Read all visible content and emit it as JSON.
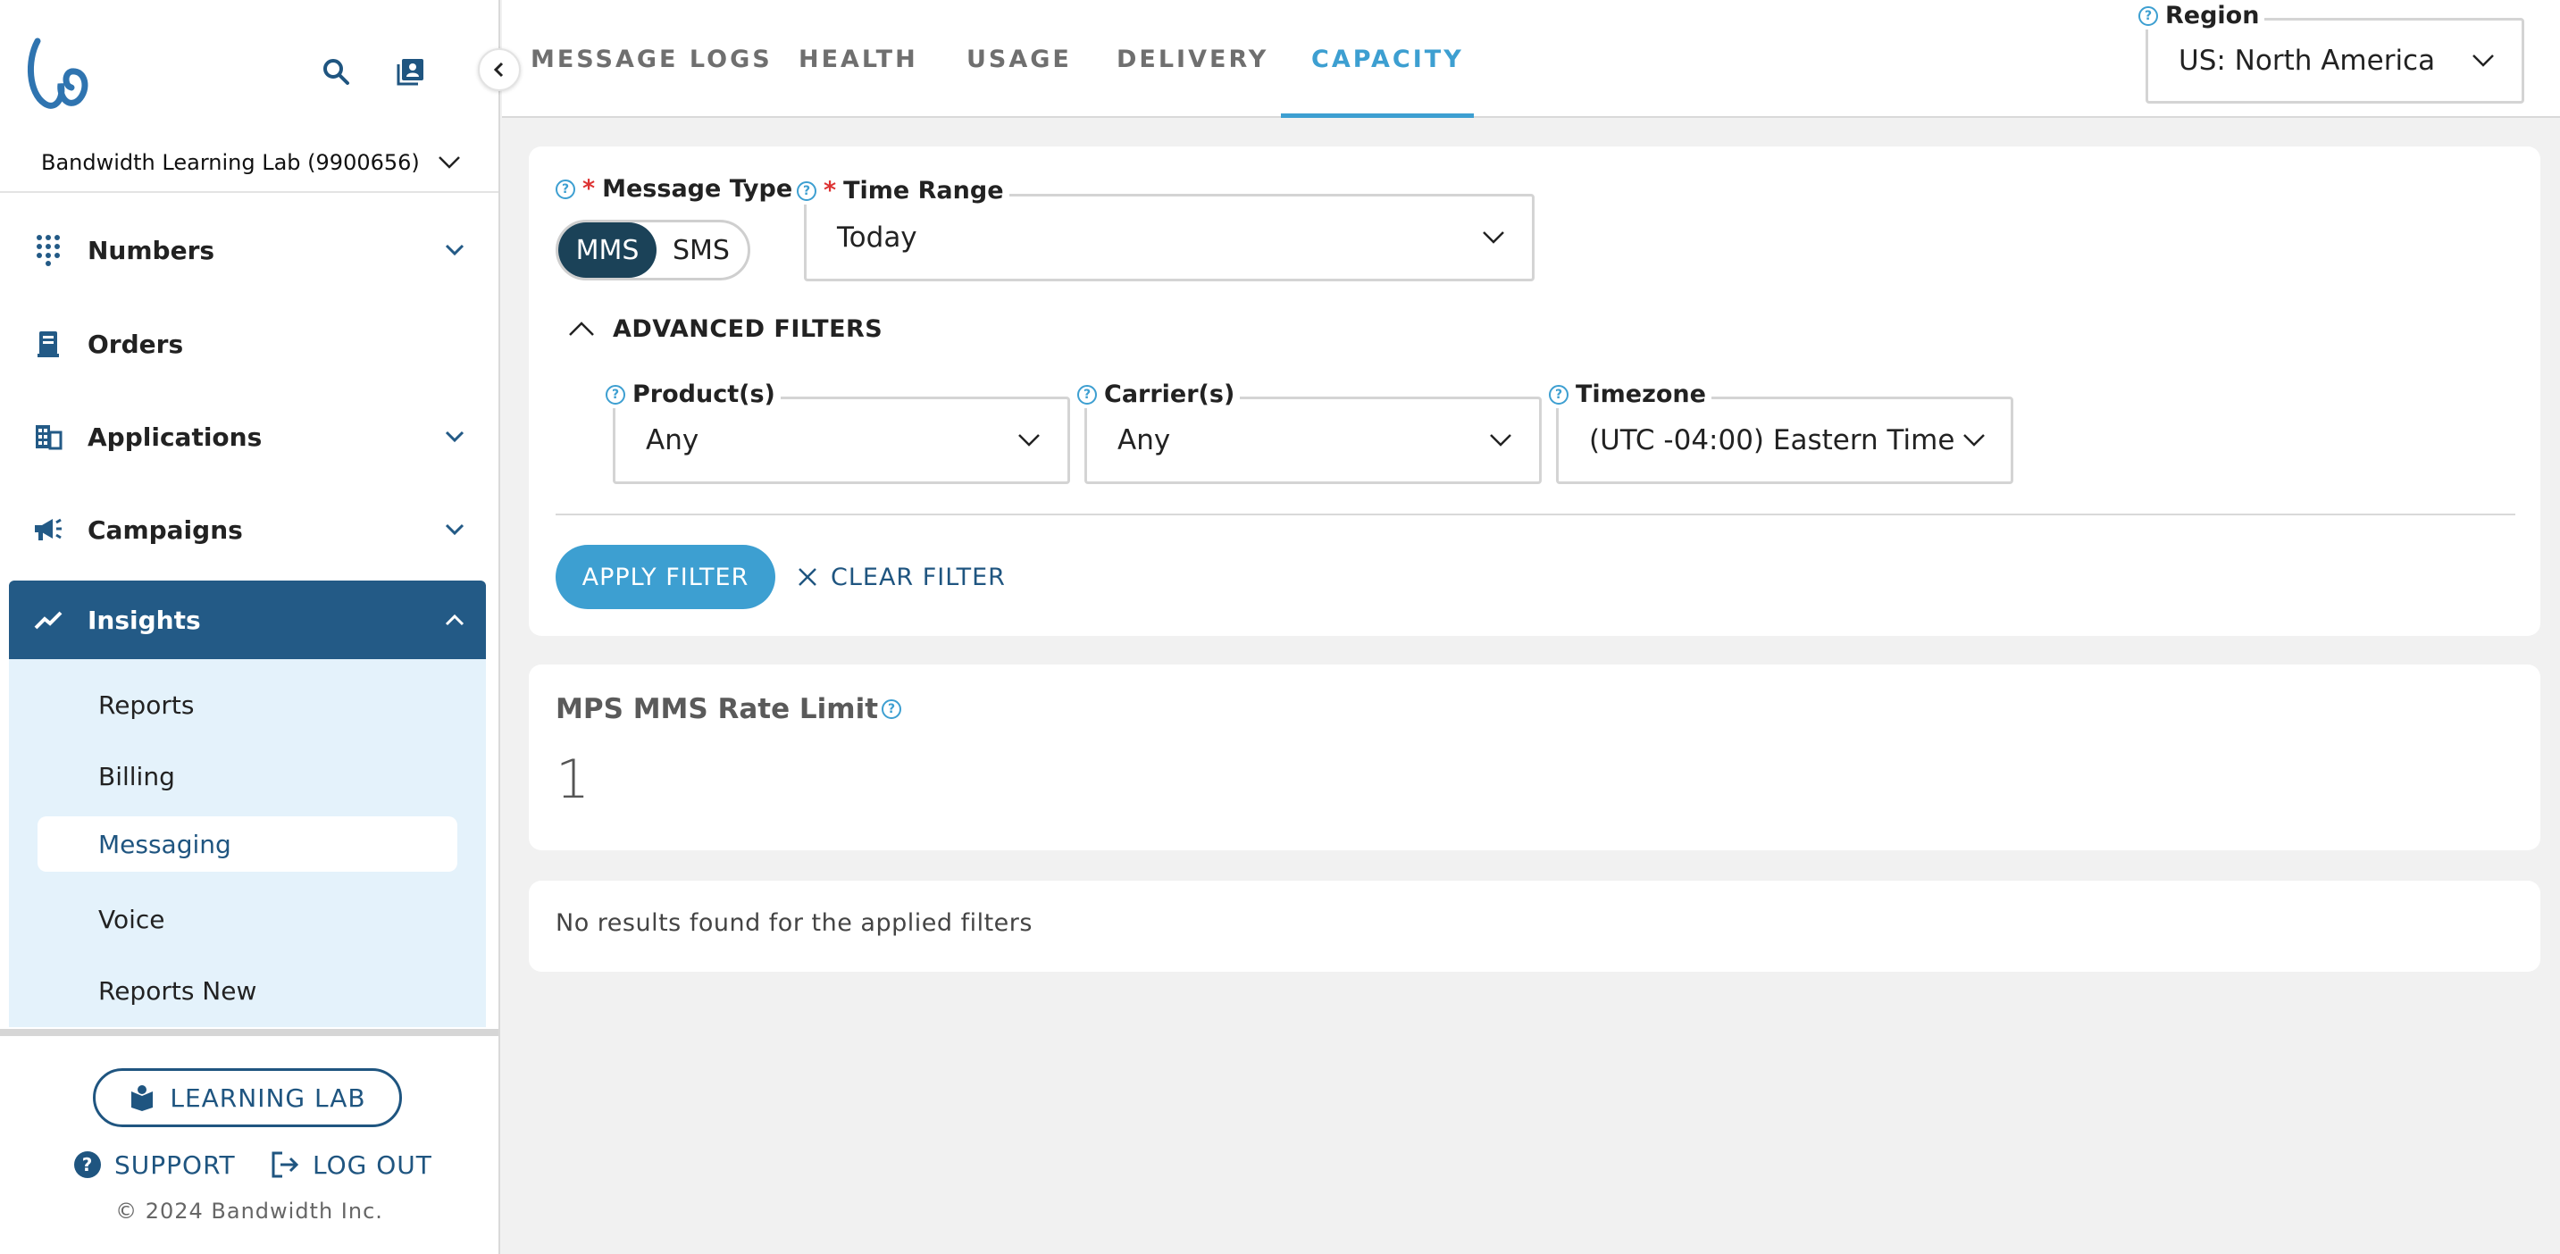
{
  "sidebar": {
    "account_name": "Bandwidth Learning Lab (9900656)",
    "nav": [
      {
        "label": "Numbers",
        "icon": "dialpad-icon",
        "expandable": true
      },
      {
        "label": "Orders",
        "icon": "receipt-icon",
        "expandable": false
      },
      {
        "label": "Applications",
        "icon": "building-icon",
        "expandable": true
      },
      {
        "label": "Campaigns",
        "icon": "megaphone-icon",
        "expandable": true
      },
      {
        "label": "Insights",
        "icon": "trending-icon",
        "expandable": true,
        "expanded": true
      }
    ],
    "subnav": [
      {
        "label": "Reports"
      },
      {
        "label": "Billing"
      },
      {
        "label": "Messaging",
        "selected": true
      },
      {
        "label": "Voice"
      },
      {
        "label": "Reports New"
      }
    ],
    "learning_lab_label": "LEARNING LAB",
    "support_label": "SUPPORT",
    "logout_label": "LOG OUT",
    "copyright": "© 2024 Bandwidth Inc."
  },
  "tabs": [
    {
      "label": "MESSAGE LOGS"
    },
    {
      "label": "HEALTH"
    },
    {
      "label": "USAGE"
    },
    {
      "label": "DELIVERY"
    },
    {
      "label": "CAPACITY",
      "active": true
    }
  ],
  "region": {
    "label": "Region",
    "value": "US: North America"
  },
  "filters": {
    "message_type_label": "Message Type",
    "message_type_options": [
      "MMS",
      "SMS"
    ],
    "message_type_selected": "MMS",
    "time_range_label": "Time Range",
    "time_range_value": "Today",
    "advanced_label": "ADVANCED FILTERS",
    "products_label": "Product(s)",
    "products_value": "Any",
    "carriers_label": "Carrier(s)",
    "carriers_value": "Any",
    "timezone_label": "Timezone",
    "timezone_value": "(UTC -04:00) Eastern Time",
    "apply_label": "APPLY FILTER",
    "clear_label": "CLEAR FILTER"
  },
  "metric": {
    "title": "MPS MMS Rate Limit",
    "value": "1"
  },
  "results": {
    "empty_message": "No results found for the applied filters"
  },
  "colors": {
    "primary": "#235a86",
    "accent": "#3d9fd1",
    "toggle_on": "#1b4258",
    "required": "#dd3333"
  }
}
